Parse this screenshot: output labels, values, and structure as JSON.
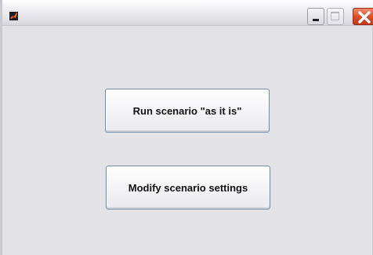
{
  "window": {
    "title": ""
  },
  "titlebar": {
    "app_icon": "matlab-logo-icon",
    "controls": {
      "minimize_icon": "minimize-icon",
      "maximize_icon": "maximize-icon",
      "close_icon": "close-icon"
    }
  },
  "main": {
    "run_button_label": "Run scenario \"as it is\"",
    "modify_button_label": "Modify scenario settings"
  },
  "colors": {
    "window_background": "#e3e3e7",
    "close_button": "#dd4a25"
  }
}
